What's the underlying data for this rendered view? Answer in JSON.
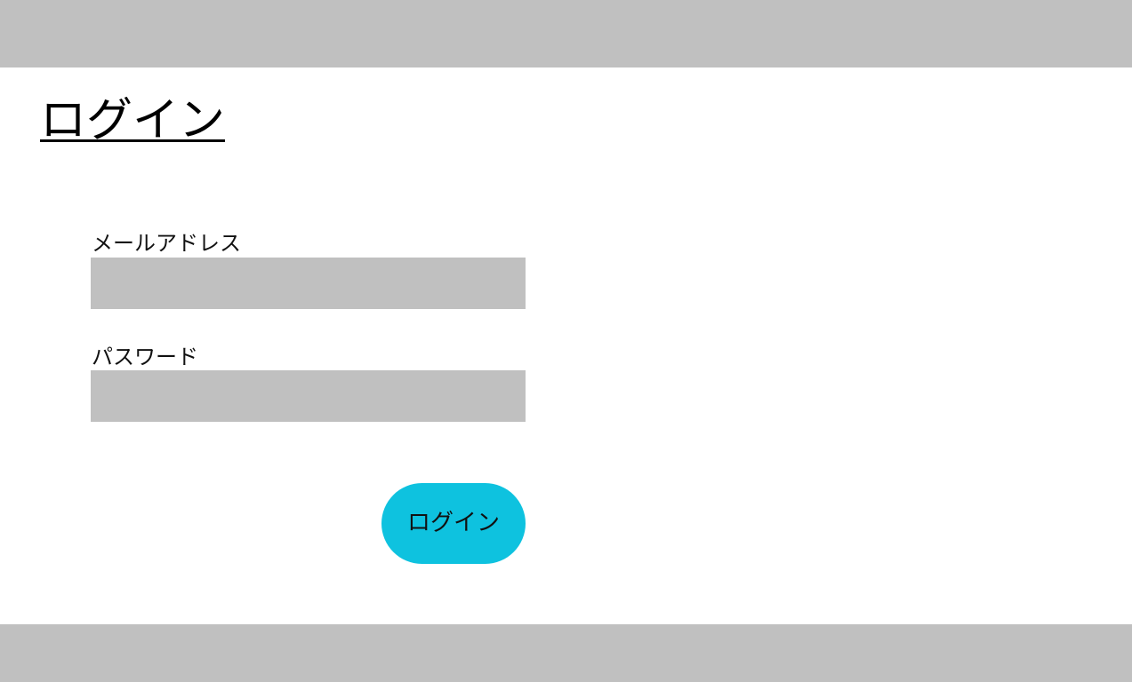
{
  "page": {
    "title": "ログイン"
  },
  "form": {
    "email_label": "メールアドレス",
    "email_value": "",
    "password_label": "パスワード",
    "password_value": "",
    "submit_label": "ログイン"
  },
  "colors": {
    "bar": "#c0c0c0",
    "field": "#c0c0c0",
    "button": "#0ec2df",
    "background": "#ffffff"
  }
}
